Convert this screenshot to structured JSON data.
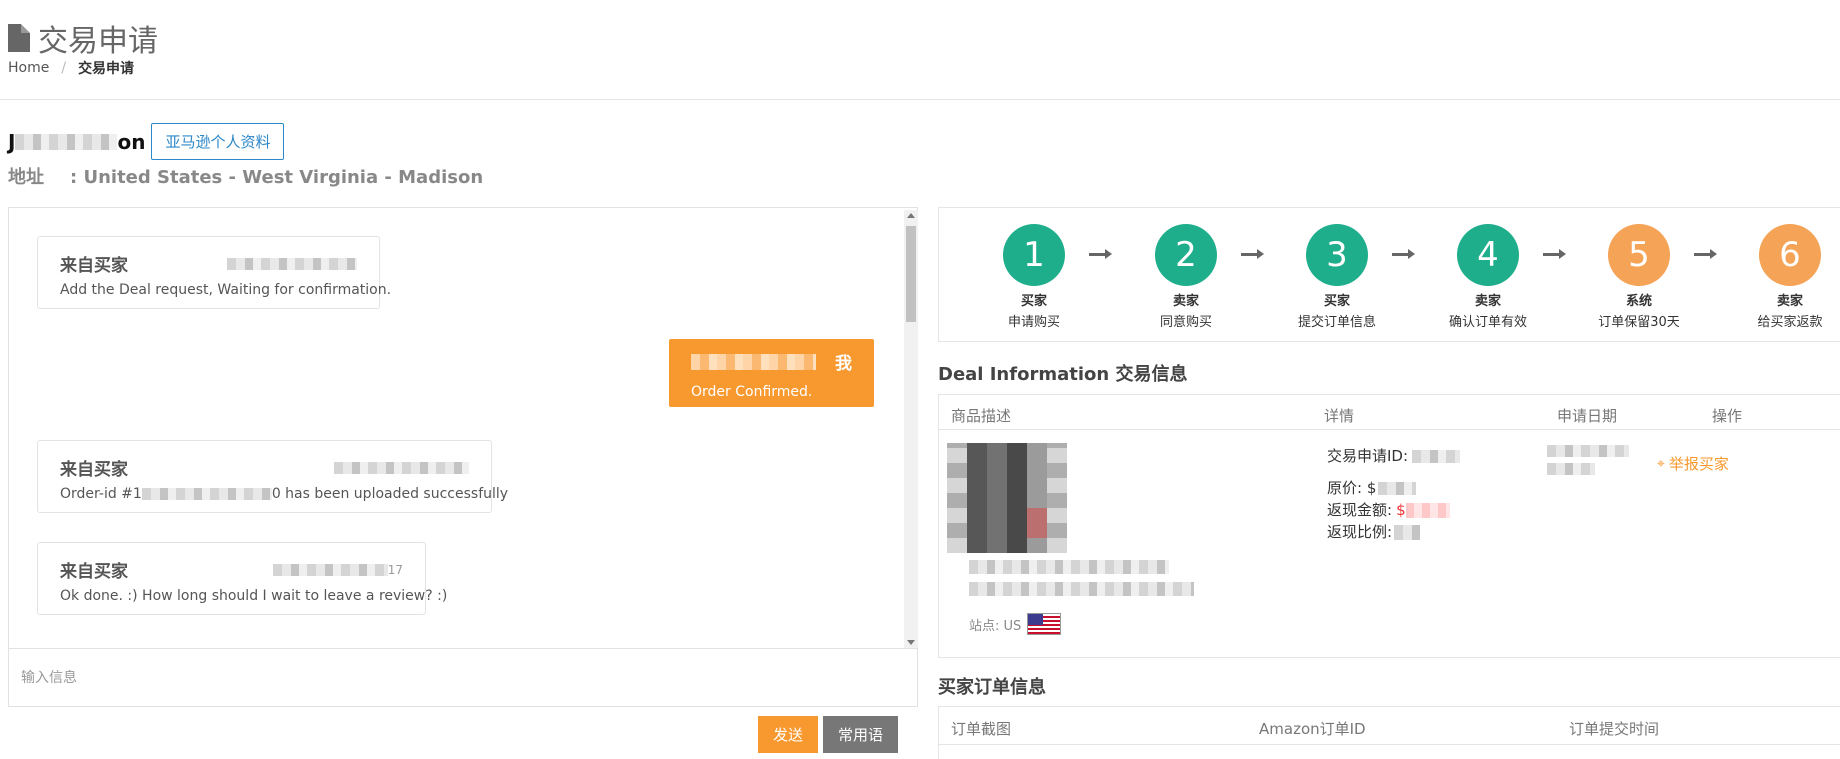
{
  "header": {
    "title": "交易申请",
    "breadcrumb": {
      "home": "Home",
      "current": "交易申请"
    }
  },
  "buyer": {
    "name_start": "J",
    "name_end": "on",
    "profile_button": "亚马逊个人资料",
    "address_label": "地址",
    "address_value": ": United States - West Virginia - Madison"
  },
  "chat": {
    "messages": [
      {
        "from": "来自买家",
        "text": "Add the Deal request, Waiting for confirmation."
      },
      {
        "from": "我",
        "text": "Order Confirmed."
      },
      {
        "from": "来自买家",
        "text_start": "Order-id #1",
        "text_end": "0 has been uploaded successfully"
      },
      {
        "from": "来自买家",
        "time_suffix": "17",
        "text": "Ok done. :) How long should I wait to leave a review? :)"
      }
    ],
    "input_placeholder": "输入信息",
    "send_button": "发送",
    "common_phrases_button": "常用语"
  },
  "steps": [
    {
      "number": "1",
      "actor": "买家",
      "desc": "申请购买",
      "color": "#1fae8c"
    },
    {
      "number": "2",
      "actor": "卖家",
      "desc": "同意购买",
      "color": "#1fae8c"
    },
    {
      "number": "3",
      "actor": "买家",
      "desc": "提交订单信息",
      "color": "#1fae8c"
    },
    {
      "number": "4",
      "actor": "卖家",
      "desc": "确认订单有效",
      "color": "#1fae8c"
    },
    {
      "number": "5",
      "actor": "系统",
      "desc": "订单保留30天",
      "color": "#f5a356"
    },
    {
      "number": "6",
      "actor": "卖家",
      "desc": "给买家返款",
      "color": "#f5a356"
    }
  ],
  "deal": {
    "section_title": "Deal Information 交易信息",
    "columns": [
      "商品描述",
      "详情",
      "申请日期",
      "操作"
    ],
    "site_label": "站点: US",
    "details": {
      "request_id_label": "交易申请ID:",
      "original_price_label": "原价: $",
      "cashback_amount_label": "返现金额:",
      "cashback_currency": "$",
      "cashback_ratio_label": "返现比例:"
    },
    "report_link": "举报买家"
  },
  "order": {
    "section_title": "买家订单信息",
    "columns": [
      "订单截图",
      "Amazon订单ID",
      "订单提交时间"
    ]
  },
  "colors": {
    "accent_orange": "#f7992f",
    "step_green": "#1fae8c",
    "step_orange": "#f5a356",
    "link_blue": "#2c88c8"
  }
}
